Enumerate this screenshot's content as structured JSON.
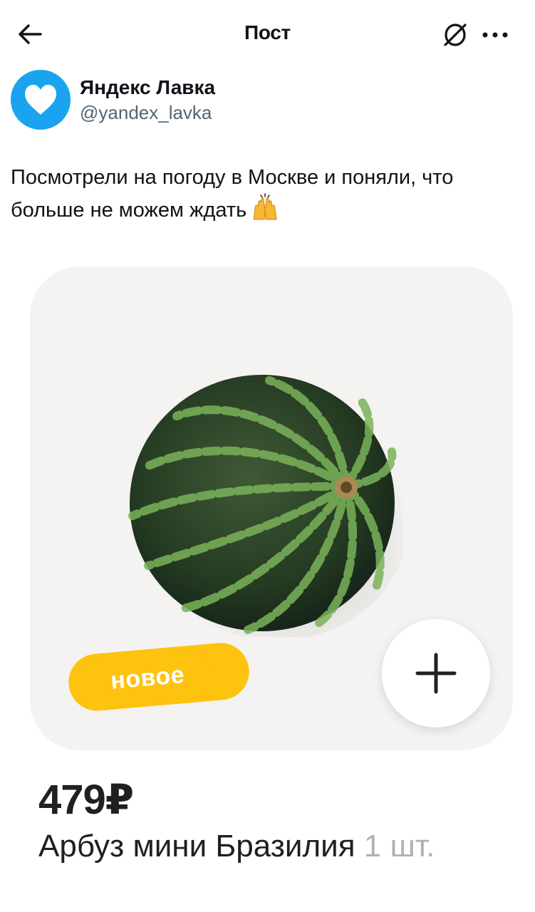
{
  "header": {
    "title": "Пост",
    "back_icon": "arrow-left-icon",
    "hide_icon": "hide-post-icon",
    "more_icon": "more-horizontal-icon"
  },
  "author": {
    "name": "Яндекс Лавка",
    "handle": "@yandex_lavka",
    "avatar_color": "#1aa3ee"
  },
  "tweet": {
    "text": "Посмотрели на погоду в Москве и поняли, что больше не можем ждать",
    "emoji": "🙌"
  },
  "product_card": {
    "badge": "новое",
    "badge_color": "#fdc30f",
    "add_icon": "plus-icon",
    "price": "479₽",
    "name": "Арбуз мини Бразилия",
    "quantity": "1 шт."
  }
}
